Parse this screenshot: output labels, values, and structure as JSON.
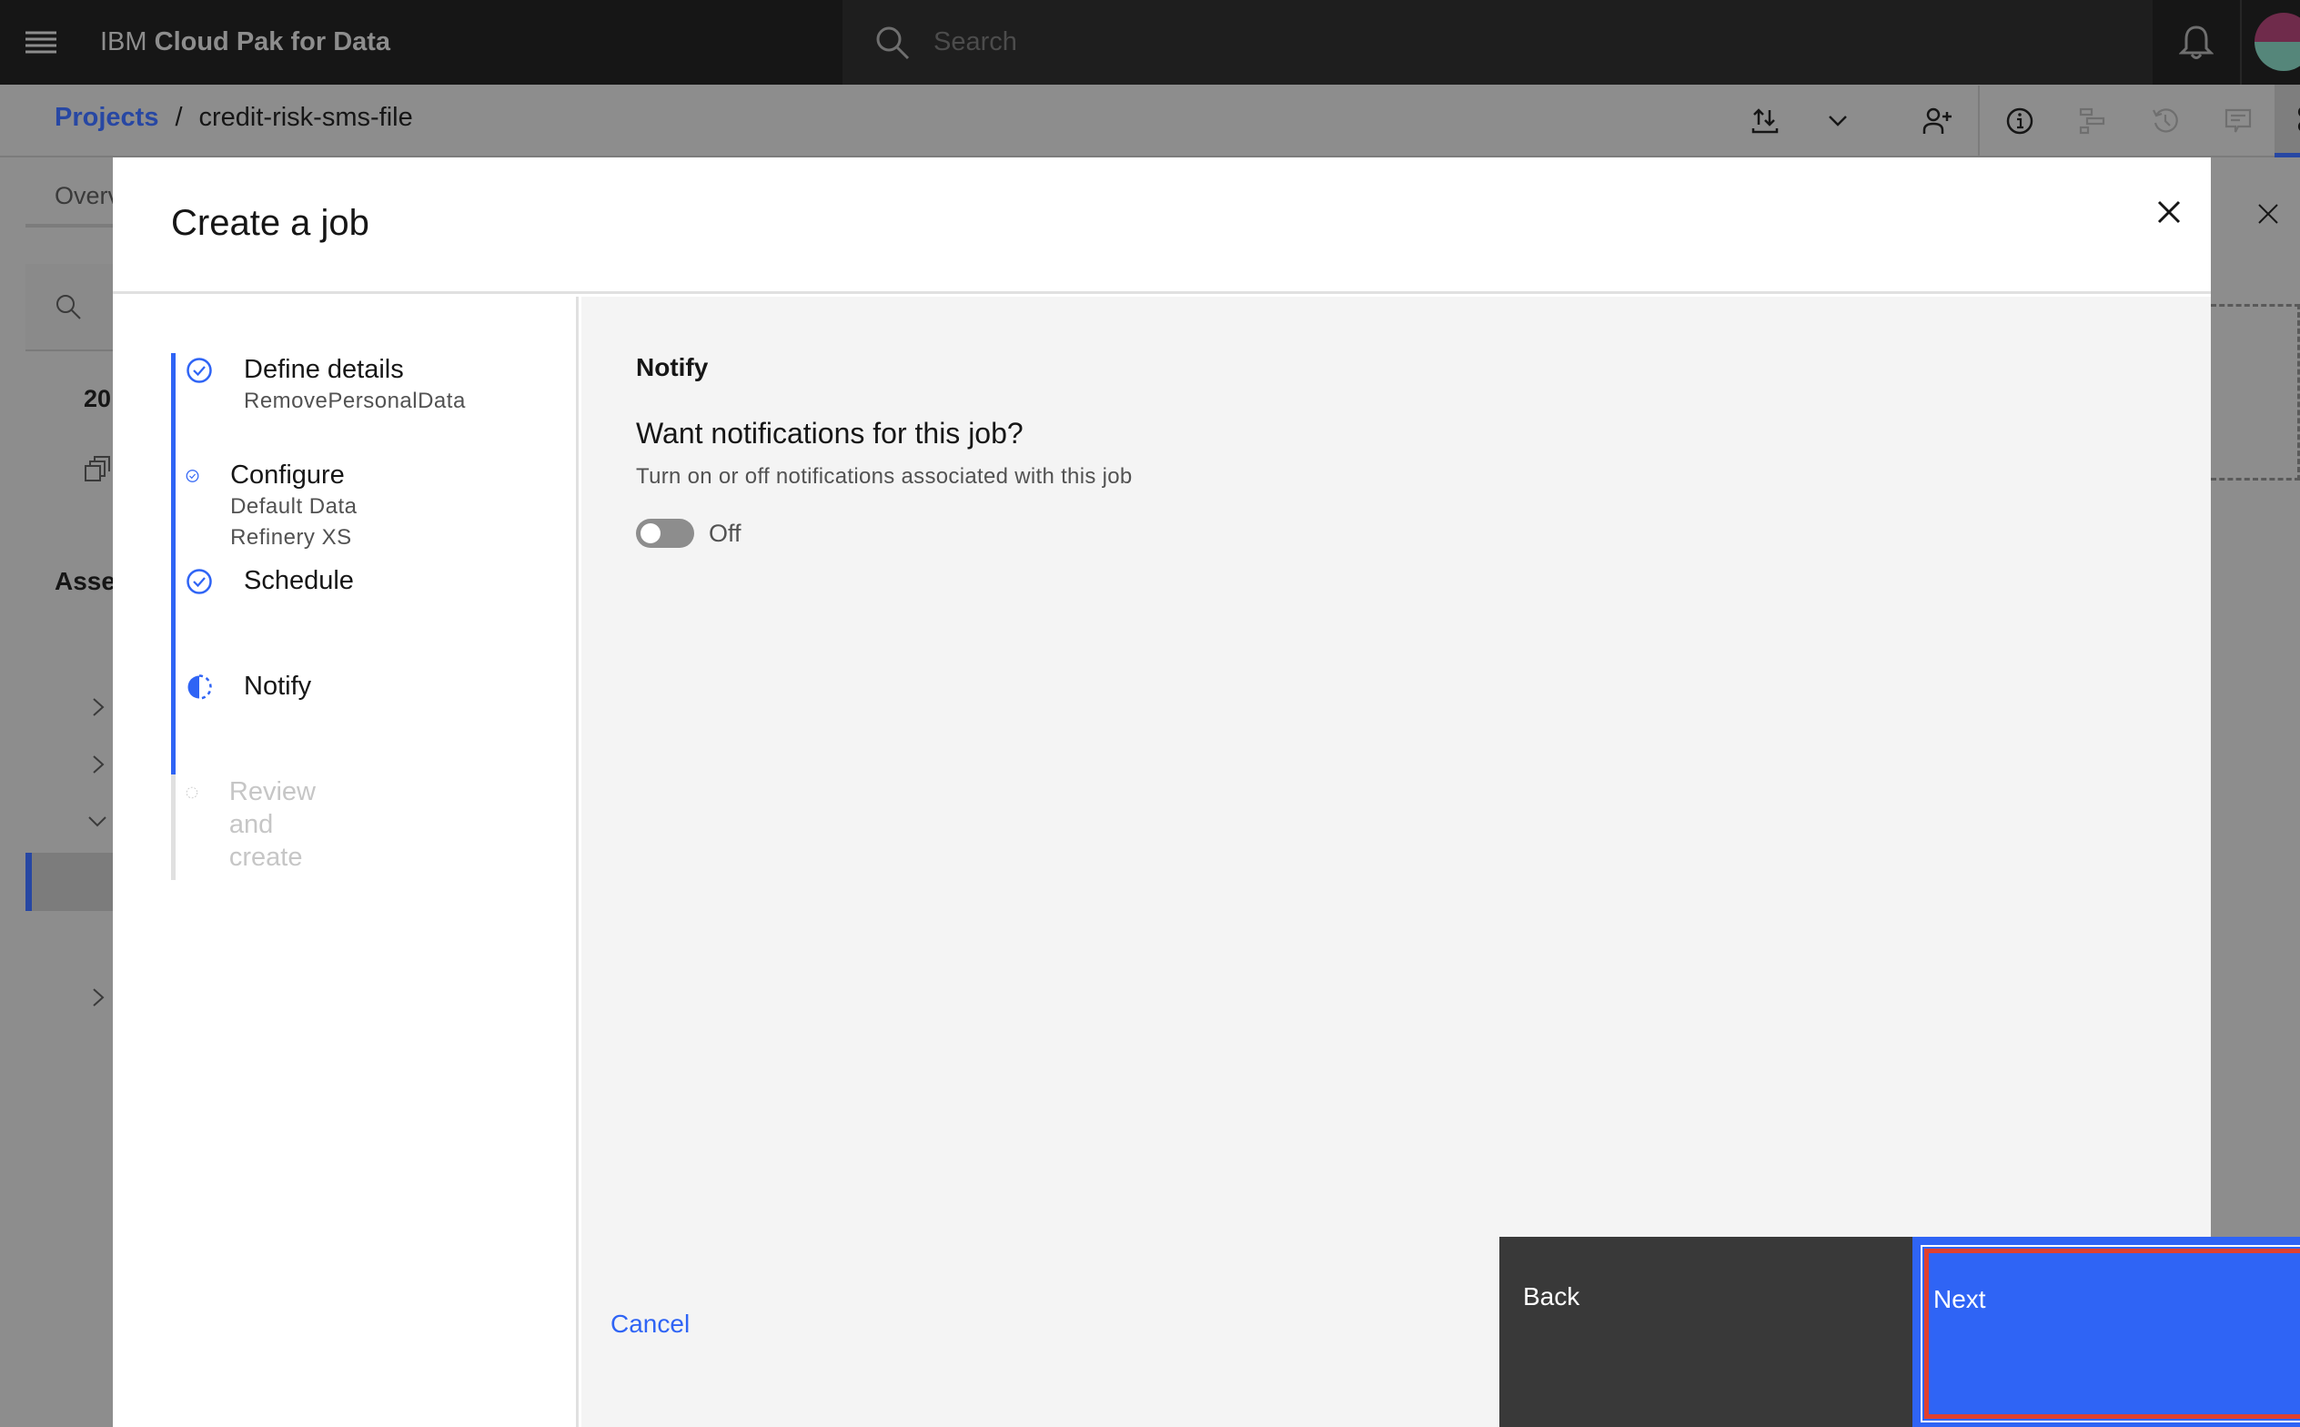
{
  "header": {
    "brand_prefix": "IBM",
    "brand_name": "Cloud Pak for Data",
    "search_placeholder": "Search"
  },
  "breadcrumb": {
    "root": "Projects",
    "separator": "/",
    "current": "credit-risk-sms-file"
  },
  "background": {
    "tab_partial": "Overv",
    "number_partial": "20",
    "assets_partial": "Asse"
  },
  "modal": {
    "title": "Create a job",
    "steps": [
      {
        "label": "Define details",
        "sub": "RemovePersonalData",
        "state": "complete"
      },
      {
        "label": "Configure",
        "sub": "Default Data Refinery XS",
        "state": "complete"
      },
      {
        "label": "Schedule",
        "sub": "",
        "state": "complete"
      },
      {
        "label": "Notify",
        "sub": "",
        "state": "current"
      },
      {
        "label": "Review and create",
        "sub": "",
        "state": "incomplete"
      }
    ],
    "section_title": "Notify",
    "question": "Want notifications for this job?",
    "description": "Turn on or off notifications associated with this job",
    "toggle": {
      "state": false,
      "label": "Off"
    },
    "cancel_label": "Cancel",
    "back_label": "Back",
    "next_label": "Next"
  },
  "colors": {
    "accent": "#2f64f5",
    "highlight": "#e0402e",
    "topbar": "#161616"
  }
}
